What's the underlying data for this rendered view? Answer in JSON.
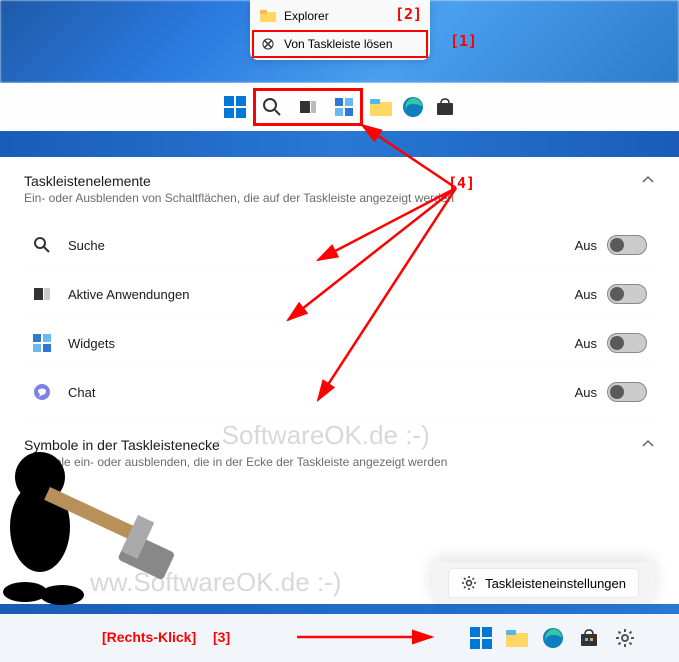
{
  "context_menu_top": {
    "items": [
      {
        "label": "Explorer",
        "icon": "folder-icon"
      },
      {
        "label": "Von Taskleiste lösen",
        "icon": "unpin-icon"
      }
    ]
  },
  "annotations": {
    "a1": "[1]",
    "a2": "[2]",
    "a3": "[3]",
    "a3_label": "[Rechts-Klick]",
    "a4": "[4]"
  },
  "settings": {
    "section1": {
      "title": "Taskleistenelemente",
      "subtitle": "Ein- oder Ausblenden von Schaltflächen, die auf der Taskleiste angezeigt werden",
      "items": [
        {
          "icon": "search-icon",
          "label": "Suche",
          "state": "Aus"
        },
        {
          "icon": "taskview-icon",
          "label": "Aktive Anwendungen",
          "state": "Aus"
        },
        {
          "icon": "widgets-icon",
          "label": "Widgets",
          "state": "Aus"
        },
        {
          "icon": "chat-icon",
          "label": "Chat",
          "state": "Aus"
        }
      ]
    },
    "section2": {
      "title": "Symbole in der Taskleistenecke",
      "subtitle": "Symbole ein- oder ausblenden, die in der Ecke der Taskleiste angezeigt werden"
    }
  },
  "context_menu_bottom": {
    "button": "Taskleisteneinstellungen"
  },
  "watermark": {
    "text1": "...SoftwareOK.de :-)",
    "text2": "ww.SoftwareOK.de :-)"
  }
}
